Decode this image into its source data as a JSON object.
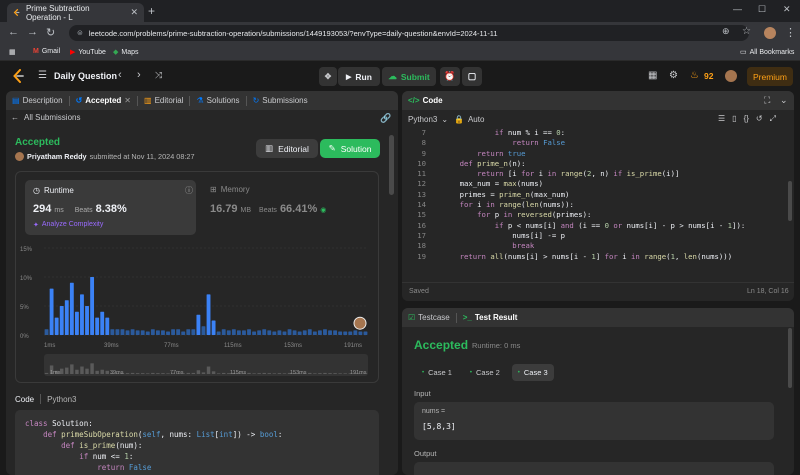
{
  "browser": {
    "tab_title": "Prime Subtraction Operation - L",
    "url": "leetcode.com/problems/prime-subtraction-operation/submissions/1449193053/?envType=daily-question&envId=2024-11-11",
    "bookmarks": [
      "Gmail",
      "YouTube",
      "Maps"
    ],
    "all_bookmarks": "All Bookmarks"
  },
  "header": {
    "title": "Daily Question",
    "run": "Run",
    "submit": "Submit",
    "streak": "92",
    "premium": "Premium"
  },
  "left_tabs": [
    "Description",
    "Accepted",
    "Editorial",
    "Solutions",
    "Submissions"
  ],
  "submission": {
    "back_label": "All Submissions",
    "status": "Accepted",
    "user": "Priyatham Reddy",
    "submitted_at": "submitted at Nov 11, 2024 08:27",
    "editorial_btn": "Editorial",
    "solution_btn": "Solution",
    "runtime_label": "Runtime",
    "runtime_value": "294",
    "runtime_unit": "ms",
    "beats_label": "Beats",
    "runtime_beats": "8.38%",
    "analyze": "Analyze Complexity",
    "memory_label": "Memory",
    "memory_value": "16.79",
    "memory_unit": "MB",
    "memory_beats": "66.41%"
  },
  "chart_data": {
    "type": "bar",
    "ylabel": "",
    "y_ticks": [
      "15%",
      "10%",
      "5%",
      "0%"
    ],
    "ylim": [
      0,
      15
    ],
    "x_ticks": [
      "1ms",
      "39ms",
      "77ms",
      "115ms",
      "153ms",
      "191ms"
    ],
    "values": [
      1,
      8,
      3,
      5,
      6,
      9,
      4,
      7,
      5,
      10,
      3,
      4,
      3,
      1,
      1,
      1,
      0.8,
      1,
      0.8,
      0.8,
      0.6,
      1,
      0.8,
      0.8,
      0.6,
      1,
      1,
      0.6,
      1,
      1,
      3.5,
      1.5,
      7,
      2.5,
      0.6,
      1,
      0.8,
      1,
      0.8,
      0.8,
      1,
      0.6,
      0.8,
      1,
      0.8,
      0.6,
      0.8,
      0.6,
      1,
      0.8,
      0.6,
      0.8,
      1,
      0.6,
      0.8,
      1,
      0.8,
      0.8,
      0.6,
      0.6,
      0.6,
      0.8,
      0.6,
      0.6
    ],
    "highlight_index": 0,
    "colors": {
      "bar": "#3b82f6",
      "bar_dim": "#2b5a9c"
    }
  },
  "code_meta": {
    "label": "Code",
    "lang": "Python3"
  },
  "left_code": [
    "class Solution:",
    "    def primeSubOperation(self, nums: List[int]) -> bool:",
    "        def is_prime(num):",
    "            if num <= 1:",
    "                return False"
  ],
  "editor": {
    "title": "Code",
    "lang": "Python3",
    "auto": "Auto",
    "saved": "Saved",
    "cursor": "Ln 18, Col 16",
    "start_line": 7,
    "lines": [
      "            if num % i == 0:",
      "                return False",
      "        return true",
      "    def prime_n(n):",
      "        return [i for i in range(2, n) if is_prime(i)]",
      "    max_num = max(nums)",
      "    primes = prime_n(max_num)",
      "    for i in range(len(nums)):",
      "        for p in reversed(primes):",
      "            if p < nums[i] and (i == 0 or nums[i] - p > nums[i - 1]):",
      "                nums[i] -= p",
      "                break",
      "    return all(nums[i] > nums[i - 1] for i in range(1, len(nums)))"
    ]
  },
  "testresult": {
    "tab_testcase": "Testcase",
    "tab_result": "Test Result",
    "status": "Accepted",
    "runtime": "Runtime: 0 ms",
    "cases": [
      "Case 1",
      "Case 2",
      "Case 3"
    ],
    "input_label": "Input",
    "var_name": "nums =",
    "var_value": "[5,8,3]",
    "output_label": "Output"
  }
}
